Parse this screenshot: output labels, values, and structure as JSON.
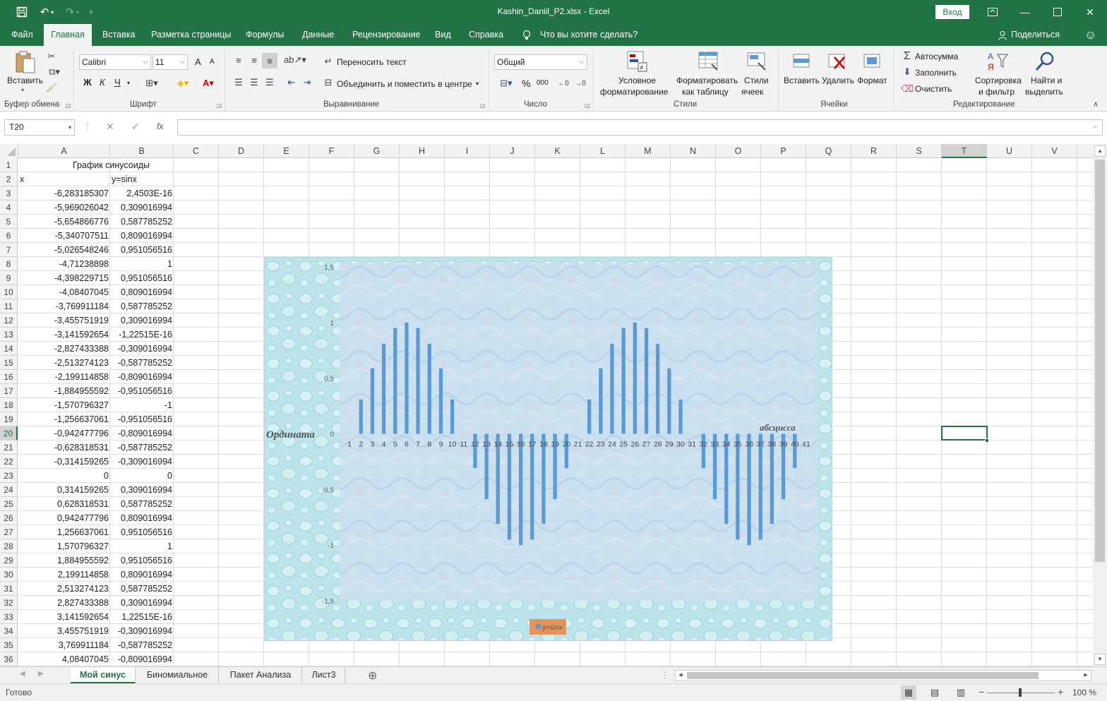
{
  "titlebar": {
    "title": "Kashin_Daniil_P2.xlsx  -  Excel",
    "login": "Вход"
  },
  "tabs": [
    "Файл",
    "Главная",
    "Вставка",
    "Разметка страницы",
    "Формулы",
    "Данные",
    "Рецензирование",
    "Вид",
    "Справка"
  ],
  "tell_me": "Что вы хотите сделать?",
  "share": "Поделиться",
  "ribbon": {
    "clipboard": {
      "paste": "Вставить",
      "label": "Буфер обмена"
    },
    "font": {
      "name": "Calibri",
      "size": "11",
      "bold": "Ж",
      "italic": "К",
      "underline": "Ч",
      "grow": "A",
      "shrink": "A",
      "label": "Шрифт"
    },
    "align": {
      "wrap": "Переносить текст",
      "merge": "Объединить и поместить в центре",
      "label": "Выравнивание"
    },
    "number": {
      "format": "Общий",
      "percent": "%",
      "thousands": "000",
      "label": "Число"
    },
    "styles": {
      "conditional_1": "Условное",
      "conditional_2": "форматирование",
      "table_1": "Форматировать",
      "table_2": "как таблицу",
      "cell_1": "Стили",
      "cell_2": "ячеек",
      "label": "Стили"
    },
    "cells": {
      "insert": "Вставить",
      "delete": "Удалить",
      "format": "Формат",
      "label": "Ячейки"
    },
    "editing": {
      "autosum": "Автосумма",
      "fill": "Заполнить",
      "clear": "Очистить",
      "sort_1": "Сортировка",
      "sort_2": "и фильтр",
      "find_1": "Найти и",
      "find_2": "выделить",
      "label": "Редактирование"
    }
  },
  "formula_bar": {
    "name_box": "T20",
    "fx": "fx",
    "formula": ""
  },
  "columns": [
    "A",
    "B",
    "C",
    "D",
    "E",
    "F",
    "G",
    "H",
    "I",
    "J",
    "K",
    "L",
    "M",
    "N",
    "O",
    "P",
    "Q",
    "R",
    "S",
    "T",
    "U",
    "V"
  ],
  "selected_column": "T",
  "selected_row": "20",
  "sheet": {
    "title": "График синусоиды",
    "header_x": "x",
    "header_y": "y=sinx",
    "rows": [
      [
        "-6,283185307",
        "2,4503E-16"
      ],
      [
        "-5,969026042",
        "0,309016994"
      ],
      [
        "-5,654866776",
        "0,587785252"
      ],
      [
        "-5,340707511",
        "0,809016994"
      ],
      [
        "-5,026548246",
        "0,951056516"
      ],
      [
        "-4,71238898",
        "1"
      ],
      [
        "-4,398229715",
        "0,951056516"
      ],
      [
        "-4,08407045",
        "0,809016994"
      ],
      [
        "-3,769911184",
        "0,587785252"
      ],
      [
        "-3,455751919",
        "0,309016994"
      ],
      [
        "-3,141592654",
        "-1,22515E-16"
      ],
      [
        "-2,827433388",
        "-0,309016994"
      ],
      [
        "-2,513274123",
        "-0,587785252"
      ],
      [
        "-2,199114858",
        "-0,809016994"
      ],
      [
        "-1,884955592",
        "-0,951056516"
      ],
      [
        "-1,570796327",
        "-1"
      ],
      [
        "-1,256637061",
        "-0,951056516"
      ],
      [
        "-0,942477796",
        "-0,809016994"
      ],
      [
        "-0,628318531",
        "-0,587785252"
      ],
      [
        "-0,314159265",
        "-0,309016994"
      ],
      [
        "0",
        "0"
      ],
      [
        "0,314159265",
        "0,309016994"
      ],
      [
        "0,628318531",
        "0,587785252"
      ],
      [
        "0,942477796",
        "0,809016994"
      ],
      [
        "1,256637061",
        "0,951056516"
      ],
      [
        "1,570796327",
        "1"
      ],
      [
        "1,884955592",
        "0,951056516"
      ],
      [
        "2,199114858",
        "0,809016994"
      ],
      [
        "2,513274123",
        "0,587785252"
      ],
      [
        "2,827433388",
        "0,309016994"
      ],
      [
        "3,141592654",
        "1,22515E-16"
      ],
      [
        "3,455751919",
        "-0,309016994"
      ],
      [
        "3,769911184",
        "-0,587785252"
      ],
      [
        "4,08407045",
        "-0,809016994"
      ]
    ]
  },
  "chart_data": {
    "type": "bar",
    "categories": [
      "1",
      "2",
      "3",
      "4",
      "5",
      "6",
      "7",
      "8",
      "9",
      "10",
      "11",
      "12",
      "13",
      "14",
      "15",
      "16",
      "17",
      "18",
      "19",
      "20",
      "21",
      "22",
      "23",
      "24",
      "25",
      "26",
      "27",
      "28",
      "29",
      "30",
      "31",
      "32",
      "33",
      "34",
      "35",
      "36",
      "37",
      "38",
      "39",
      "40",
      "41"
    ],
    "series": [
      {
        "name": "y=sinx",
        "values": [
          0,
          0.309016994,
          0.587785252,
          0.809016994,
          0.951056516,
          1,
          0.951056516,
          0.809016994,
          0.587785252,
          0.309016994,
          0,
          -0.309016994,
          -0.587785252,
          -0.809016994,
          -0.951056516,
          -1,
          -0.951056516,
          -0.809016994,
          -0.587785252,
          -0.309016994,
          0,
          0.309016994,
          0.587785252,
          0.809016994,
          0.951056516,
          1,
          0.951056516,
          0.809016994,
          0.587785252,
          0.309016994,
          0,
          -0.309016994,
          -0.587785252,
          -0.809016994,
          -0.951056516,
          -1,
          -0.951056516,
          -0.809016994,
          -0.587785252,
          -0.309016994,
          0
        ],
        "color": "#5b9bd5"
      }
    ],
    "ylabel": "Ордината",
    "xlabel": "абсцисса",
    "yticks": [
      "1,5",
      "1",
      "0,5",
      "0",
      "-0,5",
      "-1",
      "-1,5"
    ],
    "ylim": [
      -1.5,
      1.5
    ],
    "grid": false,
    "legend": "bottom"
  },
  "sheets": [
    "Мой синус",
    "Биномиальное",
    "Пакет Анализа",
    "Лист3"
  ],
  "active_sheet": "Мой синус",
  "status": {
    "ready": "Готово",
    "zoom": "100 %"
  },
  "colors": {
    "accent": "#217346",
    "bar": "#5b9bd5",
    "legend_bg": "#e6955a"
  }
}
